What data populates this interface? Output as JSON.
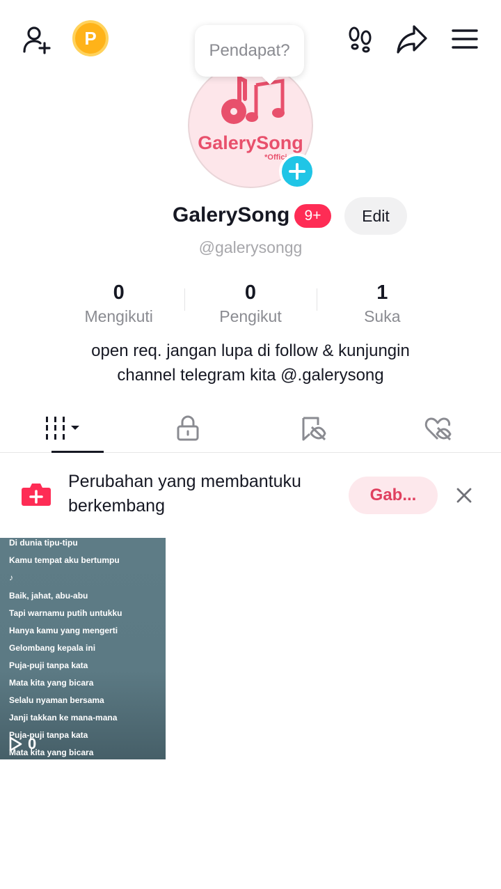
{
  "topbar": {
    "add_user_icon": "add-user-icon",
    "coin_label": "P",
    "footprint_icon": "footprint-icon",
    "share_icon": "share-icon",
    "menu_icon": "hamburger-menu-icon"
  },
  "tooltip": {
    "text": "Pendapat?"
  },
  "avatar": {
    "title": "GalerySong",
    "subtitle": "*Official*"
  },
  "profile": {
    "name": "GalerySong",
    "notification_badge": "9+",
    "edit_label": "Edit",
    "handle": "@galerysongg"
  },
  "stats": [
    {
      "value": "0",
      "label": "Mengikuti"
    },
    {
      "value": "0",
      "label": "Pengikut"
    },
    {
      "value": "1",
      "label": "Suka"
    }
  ],
  "bio": {
    "line1": "open req. jangan lupa di follow & kunjungin",
    "line2": "channel telegram kita @.galerysong"
  },
  "tabs": [
    "videos-grid",
    "private",
    "reposts",
    "liked"
  ],
  "promo": {
    "line1": "Perubahan yang membantuku",
    "line2": "berkembang",
    "join_label": "Gab..."
  },
  "video": {
    "lyrics": [
      "Di dunia tipu-tipu",
      "Kamu tempat aku bertumpu",
      "♪",
      "Baik, jahat, abu-abu",
      "Tapi warnamu putih untukku",
      "Hanya kamu yang mengerti",
      "Gelombang kepala ini",
      "Puja-puji tanpa kata",
      "Mata kita yang bicara",
      "Selalu nyaman bersama",
      "Janji takkan ke mana-mana",
      "Puja-puji tanpa kata",
      "Mata kita yang bicara"
    ],
    "views": "0"
  },
  "colors": {
    "accent": "#fe2c55",
    "cyan": "#20c5e6",
    "coin": "#ffb319"
  }
}
